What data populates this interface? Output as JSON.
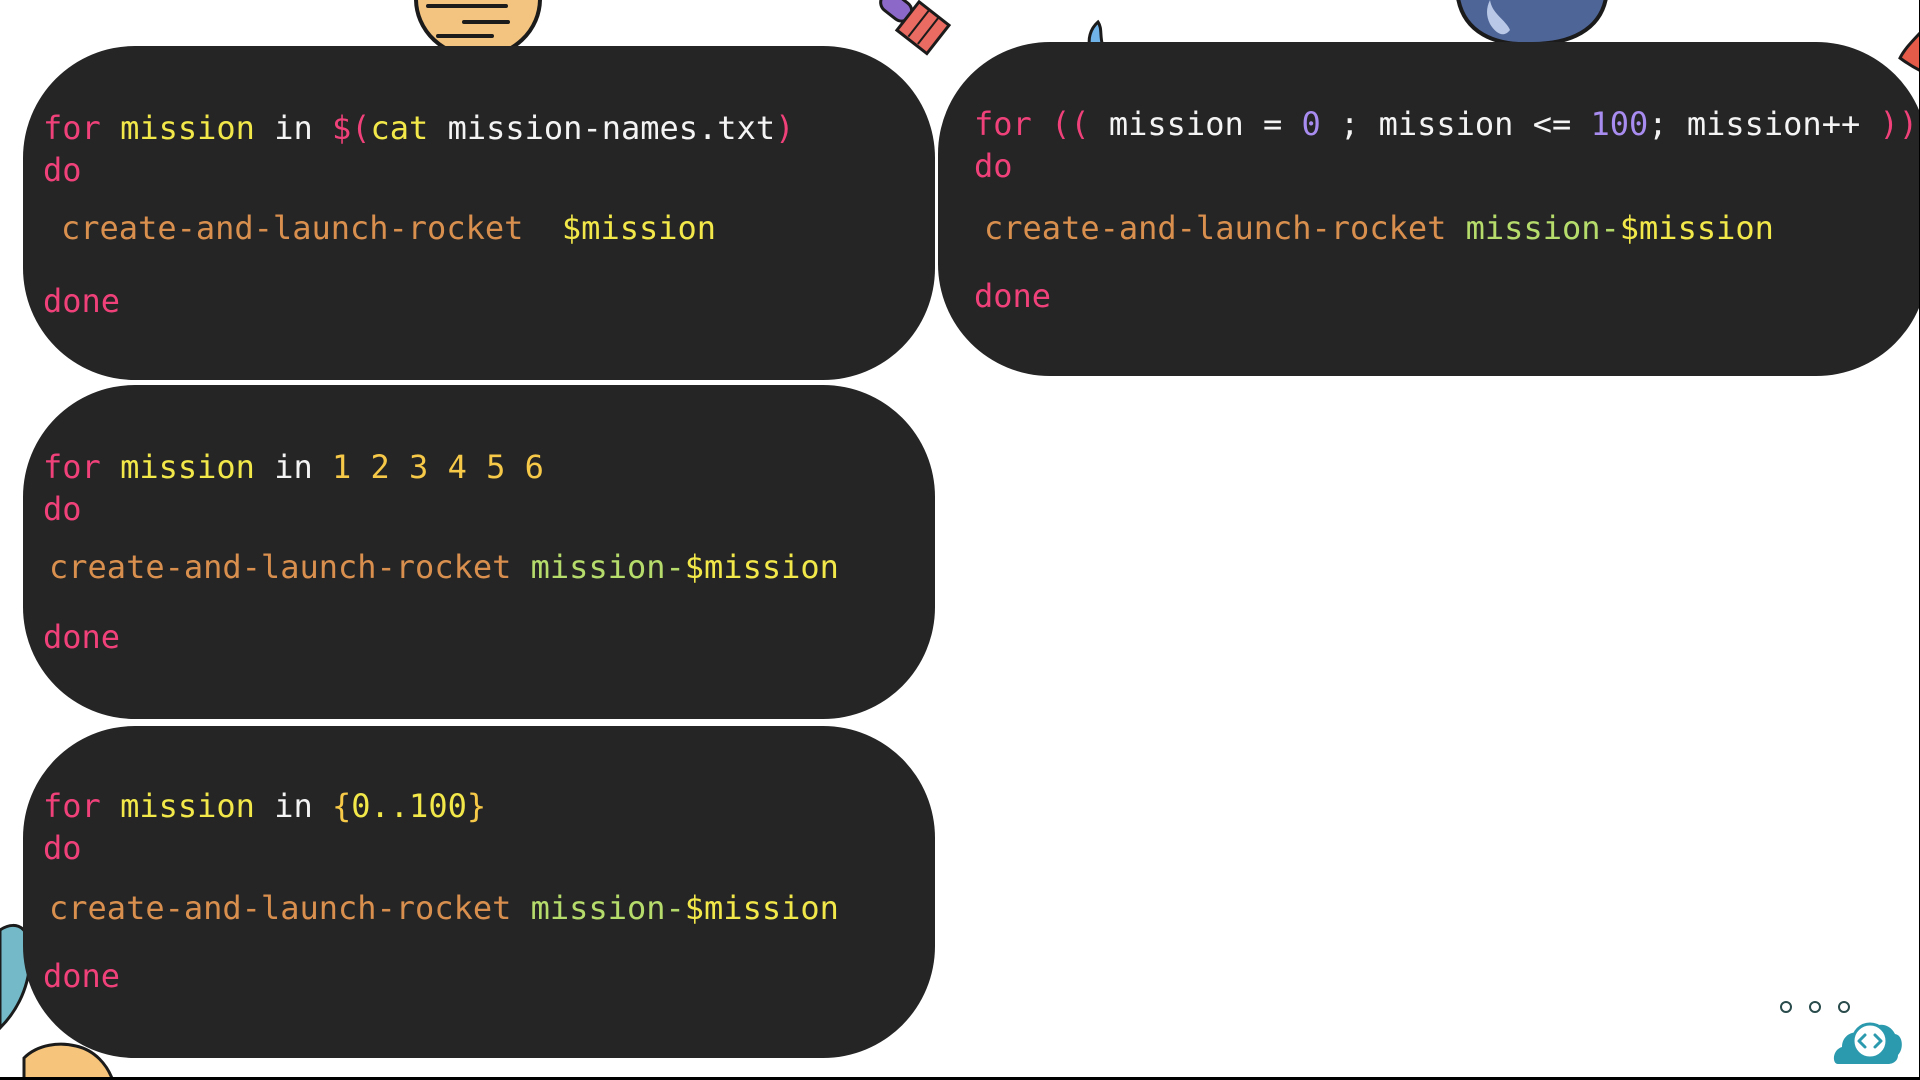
{
  "slide": {
    "colors": {
      "background": "#ffffff",
      "card": "#252525",
      "keyword_pink": "#f0417a",
      "variable_yellow": "#f2e84a",
      "builtin_white": "#f4f4f4",
      "command_orange": "#d9904e",
      "argument_green": "#b6dc6c",
      "numeric_purple": "#a98cf0",
      "number_gold": "#f7c948",
      "accent_teal": "#2b9aae"
    },
    "code_blocks": [
      {
        "id": "loop-cat-file",
        "lines": [
          {
            "tokens": [
              {
                "text": "for",
                "role": "keyword"
              },
              {
                "text": " ",
                "role": "space"
              },
              {
                "text": "mission",
                "role": "variable"
              },
              {
                "text": " ",
                "role": "space"
              },
              {
                "text": "in",
                "role": "builtin"
              },
              {
                "text": " ",
                "role": "space"
              },
              {
                "text": "$(",
                "role": "keyword"
              },
              {
                "text": "cat",
                "role": "variable"
              },
              {
                "text": " ",
                "role": "space"
              },
              {
                "text": "mission-names.txt",
                "role": "builtin"
              },
              {
                "text": ")",
                "role": "keyword"
              }
            ]
          },
          {
            "tokens": [
              {
                "text": "do",
                "role": "keyword"
              }
            ]
          },
          {
            "tokens": [
              {
                "text": "create-and-launch-rocket",
                "role": "command"
              },
              {
                "text": "  ",
                "role": "space"
              },
              {
                "text": "$mission",
                "role": "variable"
              }
            ]
          },
          {
            "tokens": [
              {
                "text": "done",
                "role": "keyword"
              }
            ]
          }
        ]
      },
      {
        "id": "loop-c-style",
        "lines": [
          {
            "tokens": [
              {
                "text": "for",
                "role": "keyword"
              },
              {
                "text": " ",
                "role": "space"
              },
              {
                "text": "((",
                "role": "keyword"
              },
              {
                "text": " ",
                "role": "space"
              },
              {
                "text": "mission = ",
                "role": "builtin"
              },
              {
                "text": "0",
                "role": "numeric"
              },
              {
                "text": " ; mission <= ",
                "role": "builtin"
              },
              {
                "text": "100",
                "role": "numeric"
              },
              {
                "text": "; mission++ ",
                "role": "builtin"
              },
              {
                "text": "))",
                "role": "keyword"
              }
            ]
          },
          {
            "tokens": [
              {
                "text": "do",
                "role": "keyword"
              }
            ]
          },
          {
            "tokens": [
              {
                "text": "create-and-launch-rocket",
                "role": "command"
              },
              {
                "text": " ",
                "role": "space"
              },
              {
                "text": "mission-",
                "role": "argument"
              },
              {
                "text": "$mission",
                "role": "variable"
              }
            ]
          },
          {
            "tokens": [
              {
                "text": "done",
                "role": "keyword"
              }
            ]
          }
        ]
      },
      {
        "id": "loop-number-list",
        "lines": [
          {
            "tokens": [
              {
                "text": "for",
                "role": "keyword"
              },
              {
                "text": " ",
                "role": "space"
              },
              {
                "text": "mission",
                "role": "variable"
              },
              {
                "text": " ",
                "role": "space"
              },
              {
                "text": "in",
                "role": "builtin"
              },
              {
                "text": " ",
                "role": "space"
              },
              {
                "text": "1 2 3 4 5 6",
                "role": "number"
              }
            ]
          },
          {
            "tokens": [
              {
                "text": "do",
                "role": "keyword"
              }
            ]
          },
          {
            "tokens": [
              {
                "text": "create-and-launch-rocket",
                "role": "command"
              },
              {
                "text": " ",
                "role": "space"
              },
              {
                "text": "mission-",
                "role": "argument"
              },
              {
                "text": "$mission",
                "role": "variable"
              }
            ]
          },
          {
            "tokens": [
              {
                "text": "done",
                "role": "keyword"
              }
            ]
          }
        ]
      },
      {
        "id": "loop-brace-range",
        "lines": [
          {
            "tokens": [
              {
                "text": "for",
                "role": "keyword"
              },
              {
                "text": " ",
                "role": "space"
              },
              {
                "text": "mission",
                "role": "variable"
              },
              {
                "text": " ",
                "role": "space"
              },
              {
                "text": "in",
                "role": "builtin"
              },
              {
                "text": " ",
                "role": "space"
              },
              {
                "text": "{",
                "role": "number"
              },
              {
                "text": "0..100",
                "role": "variable"
              },
              {
                "text": "}",
                "role": "number"
              }
            ]
          },
          {
            "tokens": [
              {
                "text": "do",
                "role": "keyword"
              }
            ]
          },
          {
            "tokens": [
              {
                "text": "create-and-launch-rocket",
                "role": "command"
              },
              {
                "text": " ",
                "role": "space"
              },
              {
                "text": "mission-",
                "role": "argument"
              },
              {
                "text": "$mission",
                "role": "variable"
              }
            ]
          },
          {
            "tokens": [
              {
                "text": "done",
                "role": "keyword"
              }
            ]
          }
        ]
      }
    ],
    "decorations": [
      {
        "name": "sun-icon"
      },
      {
        "name": "telescope-icon"
      },
      {
        "name": "moon-icon"
      },
      {
        "name": "planet-icon"
      },
      {
        "name": "rocket-fin-icon"
      },
      {
        "name": "leaf-icon"
      },
      {
        "name": "cloud-icon"
      }
    ],
    "controls": {
      "more_icon": "more-horizontal-icon",
      "logo_icon": "code-cloud-logo-icon"
    }
  }
}
